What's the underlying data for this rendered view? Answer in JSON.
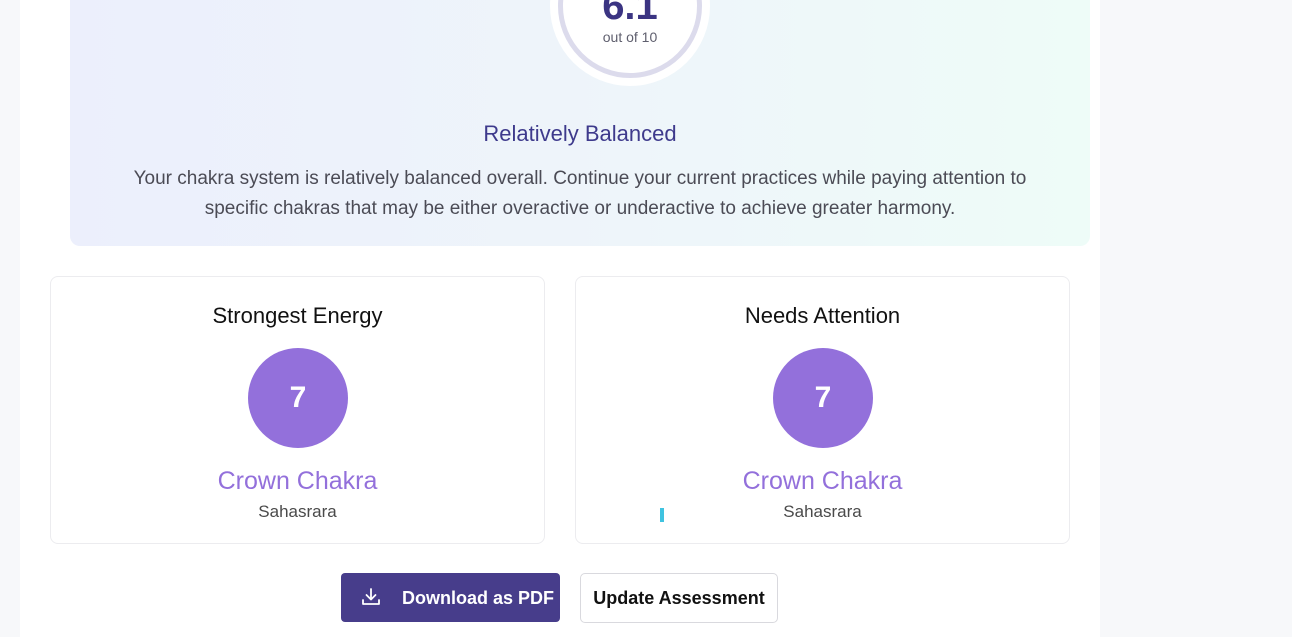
{
  "score": {
    "value": "6.1",
    "out_of_label": "out of 10",
    "status_title": "Relatively Balanced",
    "description": "Your chakra system is relatively balanced overall. Continue your current practices while paying attention to specific chakras that may be either overactive or underactive to achieve greater harmony."
  },
  "strongest": {
    "heading": "Strongest Energy",
    "number": "7",
    "name": "Crown Chakra",
    "sanskrit": "Sahasrara",
    "color": "#9370db"
  },
  "attention": {
    "heading": "Needs Attention",
    "number": "7",
    "name": "Crown Chakra",
    "sanskrit": "Sahasrara",
    "color": "#9370db"
  },
  "actions": {
    "download_label": "Download as PDF",
    "download_icon": "download-icon",
    "update_label": "Update Assessment",
    "primary_color": "#473d8b"
  }
}
